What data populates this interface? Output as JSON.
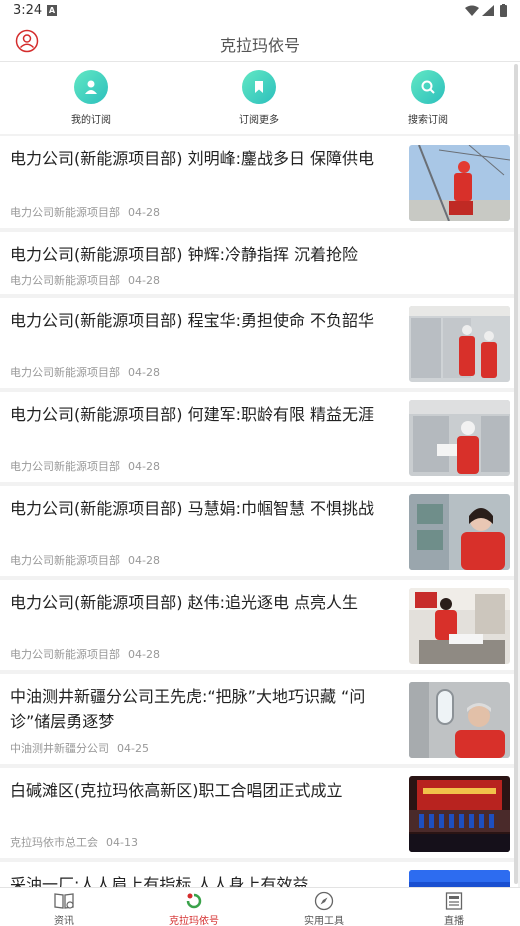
{
  "status": {
    "time": "3:24",
    "notif_letter": "A"
  },
  "header": {
    "title": "克拉玛依号"
  },
  "quick": [
    {
      "label": "我的订阅",
      "icon": "person-icon"
    },
    {
      "label": "订阅更多",
      "icon": "bookmark-icon"
    },
    {
      "label": "搜索订阅",
      "icon": "search-icon"
    }
  ],
  "articles": [
    {
      "title": "电力公司(新能源项目部) 刘明峰:鏖战多日  保障供电",
      "source": "电力公司新能源项目部",
      "date": "04-28"
    },
    {
      "title": "电力公司(新能源项目部) 钟辉:冷静指挥  沉着抢险",
      "source": "电力公司新能源项目部",
      "date": "04-28"
    },
    {
      "title": "电力公司(新能源项目部) 程宝华:勇担使命  不负韶华",
      "source": "电力公司新能源项目部",
      "date": "04-28"
    },
    {
      "title": "电力公司(新能源项目部) 何建军:职龄有限  精益无涯",
      "source": "电力公司新能源项目部",
      "date": "04-28"
    },
    {
      "title": "电力公司(新能源项目部) 马慧娟:巾帼智慧  不惧挑战",
      "source": "电力公司新能源项目部",
      "date": "04-28"
    },
    {
      "title": "电力公司(新能源项目部) 赵伟:追光逐电  点亮人生",
      "source": "电力公司新能源项目部",
      "date": "04-28"
    },
    {
      "title": "中油测井新疆分公司王先虎:“把脉”大地巧识藏  “问诊”储层勇逐梦",
      "source": "中油测井新疆分公司",
      "date": "04-25"
    },
    {
      "title": "白碱滩区(克拉玛依高新区)职工合唱团正式成立",
      "source": "克拉玛依市总工会",
      "date": "04-13"
    },
    {
      "title": "采油一厂:人人肩上有指标  人人身上有效益",
      "source": "",
      "date": ""
    }
  ],
  "nav": [
    {
      "label": "资讯",
      "icon": "book-icon"
    },
    {
      "label": "克拉玛依号",
      "icon": "karamay-logo-icon"
    },
    {
      "label": "实用工具",
      "icon": "compass-icon"
    },
    {
      "label": "直播",
      "icon": "news-icon"
    }
  ],
  "colors": {
    "accent": "#d42c2c",
    "teal_start": "#62e8c3",
    "teal_end": "#2cbfbd"
  }
}
